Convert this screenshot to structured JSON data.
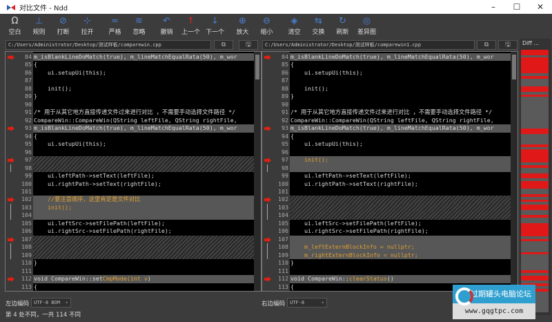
{
  "window": {
    "title": "对比文件 - Ndd",
    "minimize": "–",
    "maximize": "☐",
    "close": "✕"
  },
  "toolbar": [
    {
      "label": "空白",
      "icon": "omega-icon",
      "glyph": "Ω"
    },
    {
      "label": "规则",
      "icon": "rule-icon",
      "glyph": "⊥"
    },
    {
      "label": "打断",
      "icon": "break-icon",
      "glyph": "⊘"
    },
    {
      "label": "拉开",
      "icon": "spread-icon",
      "glyph": "⊹"
    },
    {
      "label": "严格",
      "icon": "strict-icon",
      "glyph": "≈"
    },
    {
      "label": "忽略",
      "icon": "ignore-icon",
      "glyph": "≋"
    },
    {
      "label": "撤销",
      "icon": "undo-icon",
      "glyph": "↶"
    },
    {
      "label": "上一个",
      "icon": "arrow-up-icon",
      "glyph": "↑",
      "color": "#e02020"
    },
    {
      "label": "下一个",
      "icon": "arrow-down-icon",
      "glyph": "↓"
    },
    {
      "label": "放大",
      "icon": "zoom-in-icon",
      "glyph": "⊕"
    },
    {
      "label": "缩小",
      "icon": "zoom-out-icon",
      "glyph": "⊖"
    },
    {
      "label": "清空",
      "icon": "clear-icon",
      "glyph": "◈"
    },
    {
      "label": "交换",
      "icon": "swap-icon",
      "glyph": "⇆"
    },
    {
      "label": "刷新",
      "icon": "refresh-icon",
      "glyph": "↻"
    },
    {
      "label": "差异图",
      "icon": "diff-map-icon",
      "glyph": "◎"
    }
  ],
  "left": {
    "path": "C:/Users/Administrator/Desktop/测试样板/comparewin.cpp",
    "encoding_label": "左边编码",
    "encoding": "UTF-8 BOM",
    "lines": [
      {
        "n": 84,
        "s": "diff",
        "m": "arrow",
        "seg": [
          [
            "m_isBlankLineDoMatch(true), m_lineMatchEqualRata(50), m_wor",
            ""
          ]
        ]
      },
      {
        "n": 85,
        "s": "",
        "seg": [
          [
            "{",
            ""
          ]
        ]
      },
      {
        "n": 86,
        "s": "",
        "seg": [
          [
            "    ui.setupUi(this);",
            ""
          ]
        ]
      },
      {
        "n": 87,
        "s": "",
        "seg": []
      },
      {
        "n": 88,
        "s": "",
        "seg": [
          [
            "    init();",
            ""
          ]
        ]
      },
      {
        "n": 89,
        "s": "",
        "seg": [
          [
            "}",
            ""
          ]
        ]
      },
      {
        "n": 90,
        "s": "",
        "seg": []
      },
      {
        "n": 91,
        "s": "",
        "seg": [
          [
            "/* 用于从其它地方直接传递文件过来进行对比 ，不需要手动选择文件路径 */",
            ""
          ]
        ]
      },
      {
        "n": 92,
        "s": "",
        "seg": [
          [
            "CompareWin::CompareWin(QString leftFile, QString rightFile,",
            ""
          ]
        ]
      },
      {
        "n": 93,
        "s": "diff",
        "m": "arrow",
        "seg": [
          [
            "m_isBlankLineDoMatch(true), m_lineMatchEqualRata(50), m_wor",
            ""
          ]
        ]
      },
      {
        "n": 94,
        "s": "",
        "seg": [
          [
            "{",
            ""
          ]
        ]
      },
      {
        "n": 95,
        "s": "",
        "seg": [
          [
            "    ui.setupUi(this);",
            ""
          ]
        ]
      },
      {
        "n": 96,
        "s": "",
        "seg": []
      },
      {
        "n": 97,
        "s": "hatch",
        "m": "arrow",
        "seg": []
      },
      {
        "n": 98,
        "s": "hatch",
        "m": "bar",
        "seg": []
      },
      {
        "n": 99,
        "s": "",
        "seg": [
          [
            "    ui.leftPath->setText(leftFile);",
            ""
          ]
        ]
      },
      {
        "n": 100,
        "s": "",
        "seg": [
          [
            "    ui.rightPath->setText(rightFile);",
            ""
          ]
        ]
      },
      {
        "n": 101,
        "s": "",
        "seg": []
      },
      {
        "n": 102,
        "s": "diff",
        "m": "arrow",
        "seg": [
          [
            "    //要注意顺序，这里肯定是文件对比",
            "o"
          ]
        ]
      },
      {
        "n": 103,
        "s": "diff",
        "m": "bar",
        "seg": [
          [
            "    init();",
            "o"
          ]
        ]
      },
      {
        "n": 104,
        "s": "diff",
        "m": "bar",
        "seg": []
      },
      {
        "n": 105,
        "s": "",
        "seg": [
          [
            "    ui.leftSrc->setFilePath(leftFile);",
            ""
          ]
        ]
      },
      {
        "n": 106,
        "s": "",
        "seg": [
          [
            "    ui.rightSrc->setFilePath(rightFile);",
            ""
          ]
        ]
      },
      {
        "n": 107,
        "s": "hatch",
        "m": "arrow",
        "seg": []
      },
      {
        "n": 108,
        "s": "hatch",
        "m": "bar",
        "seg": []
      },
      {
        "n": 109,
        "s": "hatch",
        "m": "bar",
        "seg": []
      },
      {
        "n": 110,
        "s": "",
        "seg": [
          [
            "}",
            ""
          ]
        ]
      },
      {
        "n": 111,
        "s": "",
        "seg": []
      },
      {
        "n": 112,
        "s": "diff",
        "m": "arrow",
        "seg": [
          [
            "void CompareWin::set",
            ""
          ],
          [
            "CmpMode(int v",
            "o"
          ],
          [
            ")",
            ""
          ]
        ]
      },
      {
        "n": 113,
        "s": "",
        "seg": [
          [
            "{",
            ""
          ]
        ]
      }
    ]
  },
  "right": {
    "path": "C:/Users/Administrator/Desktop/测试样板/comparewin1.cpp",
    "encoding_label": "右边编码",
    "encoding": "UTF-8",
    "lines": [
      {
        "n": 84,
        "s": "diff",
        "m": "arrow",
        "seg": [
          [
            "m_isBlankLineDoMatch(true), m_lineMatchEqualRata(50), m_wor",
            ""
          ]
        ]
      },
      {
        "n": 85,
        "s": "",
        "seg": [
          [
            "{",
            ""
          ]
        ]
      },
      {
        "n": 86,
        "s": "",
        "seg": [
          [
            "    ui.setupUi(this);",
            ""
          ]
        ]
      },
      {
        "n": 87,
        "s": "",
        "seg": []
      },
      {
        "n": 88,
        "s": "",
        "seg": [
          [
            "    init();",
            ""
          ]
        ]
      },
      {
        "n": 89,
        "s": "",
        "seg": [
          [
            "}",
            ""
          ]
        ]
      },
      {
        "n": 90,
        "s": "",
        "seg": []
      },
      {
        "n": 91,
        "s": "",
        "seg": [
          [
            "/* 用于从其它地方直接传递文件过来进行对比 ，不需要手动选择文件路径 */",
            ""
          ]
        ]
      },
      {
        "n": 92,
        "s": "",
        "seg": [
          [
            "CompareWin::CompareWin(QString leftFile, QString rightFile,",
            ""
          ]
        ]
      },
      {
        "n": 93,
        "s": "diff",
        "m": "arrow",
        "seg": [
          [
            "m_isBlankLineDoMatch(true), m_lineMatchEqualRata(50), m_wor",
            ""
          ]
        ]
      },
      {
        "n": 94,
        "s": "",
        "seg": [
          [
            "{",
            ""
          ]
        ]
      },
      {
        "n": 95,
        "s": "",
        "seg": [
          [
            "    ui.setupUi(this);",
            ""
          ]
        ]
      },
      {
        "n": 96,
        "s": "",
        "seg": []
      },
      {
        "n": 97,
        "s": "diff",
        "m": "arrow",
        "seg": [
          [
            "    init();",
            "o"
          ]
        ]
      },
      {
        "n": 98,
        "s": "diff",
        "m": "bar",
        "seg": []
      },
      {
        "n": 99,
        "s": "",
        "seg": [
          [
            "    ui.leftPath->setText(leftFile);",
            ""
          ]
        ]
      },
      {
        "n": 100,
        "s": "",
        "seg": [
          [
            "    ui.rightPath->setText(rightFile);",
            ""
          ]
        ]
      },
      {
        "n": 101,
        "s": "",
        "seg": []
      },
      {
        "n": 102,
        "s": "hatch",
        "m": "arrow",
        "seg": []
      },
      {
        "n": 103,
        "s": "hatch",
        "m": "bar",
        "seg": []
      },
      {
        "n": 104,
        "s": "hatch",
        "m": "bar",
        "seg": []
      },
      {
        "n": 105,
        "s": "",
        "seg": [
          [
            "    ui.leftSrc->setFilePath(leftFile);",
            ""
          ]
        ]
      },
      {
        "n": 106,
        "s": "",
        "seg": [
          [
            "    ui.rightSrc->setFilePath(rightFile);",
            ""
          ]
        ]
      },
      {
        "n": 107,
        "s": "diff",
        "m": "arrow",
        "seg": []
      },
      {
        "n": 108,
        "s": "diff",
        "m": "bar",
        "seg": [
          [
            "    m_leftExternBlockInfo = nullptr;",
            "o"
          ]
        ]
      },
      {
        "n": 109,
        "s": "diff",
        "m": "bar",
        "seg": [
          [
            "    m_rightExternBlockInfo = nullptr;",
            "o"
          ]
        ]
      },
      {
        "n": 110,
        "s": "",
        "seg": [
          [
            "}",
            ""
          ]
        ]
      },
      {
        "n": 111,
        "s": "",
        "seg": []
      },
      {
        "n": 112,
        "s": "diff",
        "m": "arrow",
        "seg": [
          [
            "void CompareWin::",
            ""
          ],
          [
            "clearStatus",
            "o"
          ],
          [
            "()",
            ""
          ]
        ]
      },
      {
        "n": 113,
        "s": "",
        "seg": [
          [
            "{",
            ""
          ]
        ]
      }
    ]
  },
  "diffmap": {
    "label": "Diff ..."
  },
  "status": "第 4 处不同，一共 114 不同",
  "watermark": {
    "name": "过期罐头电脑论坛",
    "url": "www.gqgtpc.com"
  },
  "colors": {
    "diff_marker": "#e02010",
    "changed_text": "#e0a030"
  }
}
